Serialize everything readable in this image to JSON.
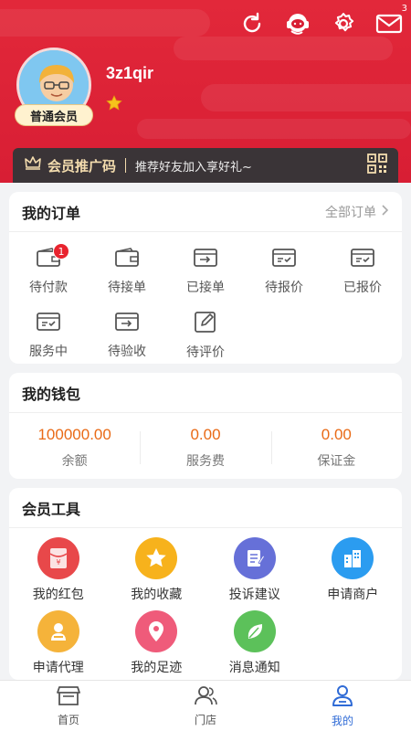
{
  "header": {
    "mail_count": "3",
    "username": "3z1qir",
    "member_level": "普通会员",
    "icons": [
      "refresh-icon",
      "customer-service-icon",
      "settings-icon",
      "mail-icon"
    ]
  },
  "promo": {
    "title": "会员推广码",
    "subtitle": "推荐好友加入享好礼~"
  },
  "orders": {
    "title": "我的订单",
    "all_link": "全部订单",
    "items": [
      {
        "label": "待付款",
        "badge": "1",
        "icon": "wallet-icon"
      },
      {
        "label": "待接单",
        "icon": "wallet-icon"
      },
      {
        "label": "已接单",
        "icon": "box-arrow-icon"
      },
      {
        "label": "待报价",
        "icon": "box-check-icon"
      },
      {
        "label": "已报价",
        "icon": "box-check-icon"
      },
      {
        "label": "服务中",
        "icon": "box-check-icon"
      },
      {
        "label": "待验收",
        "icon": "box-arrow-icon"
      },
      {
        "label": "待评价",
        "icon": "edit-icon"
      }
    ]
  },
  "wallet": {
    "title": "我的钱包",
    "items": [
      {
        "value": "100000.00",
        "label": "余额"
      },
      {
        "value": "0.00",
        "label": "服务费"
      },
      {
        "value": "0.00",
        "label": "保证金"
      }
    ]
  },
  "tools": {
    "title": "会员工具",
    "items": [
      {
        "label": "我的红包",
        "icon": "red-packet-icon",
        "color": "#e8484a"
      },
      {
        "label": "我的收藏",
        "icon": "star-icon",
        "color": "#f7b21c"
      },
      {
        "label": "投诉建议",
        "icon": "complaint-icon",
        "color": "#6670d8"
      },
      {
        "label": "申请商户",
        "icon": "building-icon",
        "color": "#2b9cf0"
      },
      {
        "label": "申请代理",
        "icon": "agent-icon",
        "color": "#f5b33a"
      },
      {
        "label": "我的足迹",
        "icon": "location-icon",
        "color": "#ef5b7a"
      },
      {
        "label": "消息通知",
        "icon": "leaf-icon",
        "color": "#5cc15a"
      }
    ]
  },
  "nav": {
    "items": [
      {
        "label": "首页",
        "icon": "store-icon"
      },
      {
        "label": "门店",
        "icon": "users-icon"
      },
      {
        "label": "我的",
        "icon": "profile-icon",
        "active": true
      }
    ]
  },
  "colors": {
    "header_red": "#d81e34",
    "wallet_orange": "#e96a16",
    "active_blue": "#2f6bd6"
  }
}
